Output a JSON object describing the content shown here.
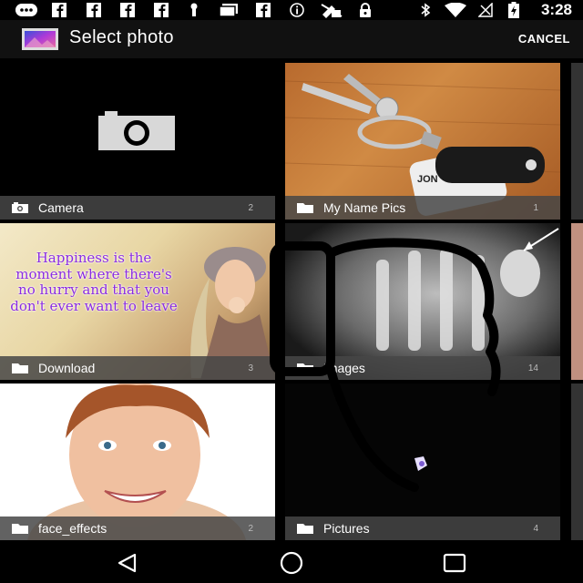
{
  "status_bar": {
    "time": "3:28",
    "icons": [
      "message-icon",
      "facebook-icon",
      "facebook-icon",
      "facebook-icon",
      "facebook-icon",
      "usb-icon",
      "gallery-icon",
      "facebook-icon",
      "info-icon",
      "no-sim-icon",
      "lock-icon",
      "bluetooth-icon",
      "wifi-icon",
      "no-signal-icon",
      "battery-charging-icon"
    ]
  },
  "action_bar": {
    "title": "Select photo",
    "cancel_label": "CANCEL",
    "app_icon": "gallery-app-icon"
  },
  "albums": [
    {
      "name": "Camera",
      "count": "2",
      "icon": "camera-icon"
    },
    {
      "name": "My Name Pics",
      "count": "1",
      "icon": "folder-icon"
    },
    {
      "name": "Download",
      "count": "3",
      "icon": "folder-icon"
    },
    {
      "name": "Images",
      "count": "14",
      "icon": "folder-icon"
    },
    {
      "name": "face_effects",
      "count": "2",
      "icon": "folder-icon"
    },
    {
      "name": "Pictures",
      "count": "4",
      "icon": "folder-icon"
    }
  ],
  "download_thumb_text": "Happiness is the moment where there's no hurry and that you don't ever want to leave",
  "keytag_text": "JON",
  "nav_bar": {
    "back": "back-icon",
    "home": "home-icon",
    "recents": "recents-icon"
  },
  "colors": {
    "action_bar": "#111111",
    "caption_bg": "#464646",
    "quote_text": "#8a2be2"
  }
}
